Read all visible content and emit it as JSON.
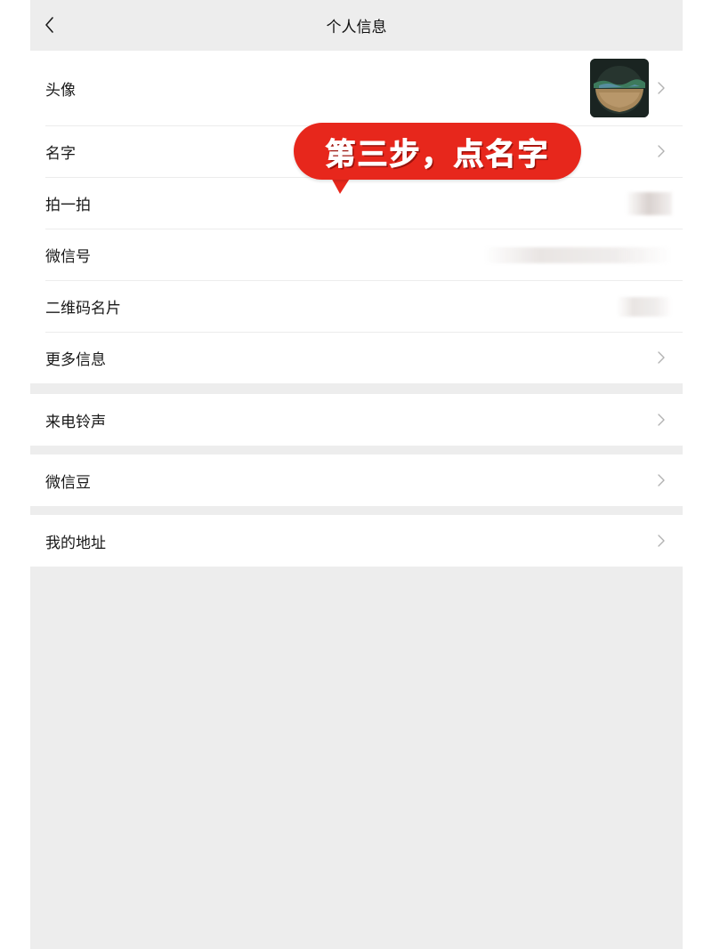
{
  "header": {
    "title": "个人信息",
    "back_icon": "chevron-left-icon"
  },
  "groups": [
    {
      "items": [
        {
          "label": "头像",
          "accessory": "avatar-image"
        },
        {
          "label": "名字",
          "accessory": "chevron-right-icon"
        },
        {
          "label": "拍一拍",
          "accessory": "blurred-value"
        },
        {
          "label": "微信号",
          "accessory": "blurred-value"
        },
        {
          "label": "二维码名片",
          "accessory": "blurred-value"
        },
        {
          "label": "更多信息",
          "accessory": "chevron-right-icon"
        }
      ]
    },
    {
      "items": [
        {
          "label": "来电铃声",
          "accessory": "chevron-right-icon"
        }
      ]
    },
    {
      "items": [
        {
          "label": "微信豆",
          "accessory": "chevron-right-icon"
        }
      ]
    },
    {
      "items": [
        {
          "label": "我的地址",
          "accessory": "chevron-right-icon"
        }
      ]
    }
  ],
  "annotation": {
    "text": "第三步，点名字",
    "color": "#e7271c"
  },
  "colors": {
    "background": "#ededed",
    "cell": "#ffffff",
    "text": "#191919",
    "chevron": "#b2b2b2"
  }
}
